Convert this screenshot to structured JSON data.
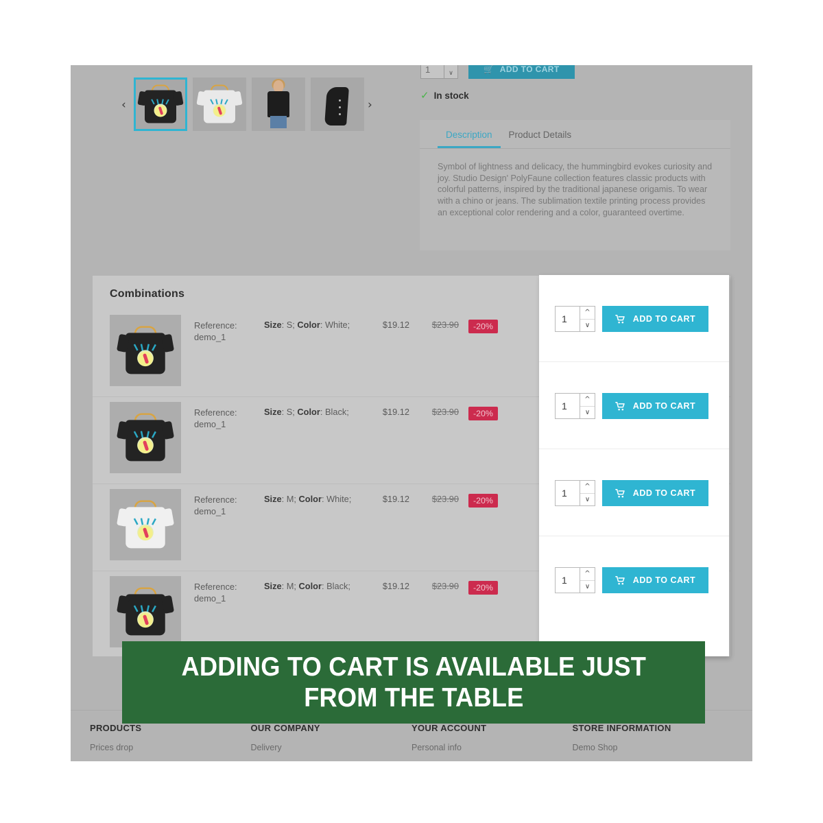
{
  "gallery": {
    "prev_label": "‹",
    "next_label": "›",
    "thumbs": [
      {
        "name": "black-tshirt-hummingbird",
        "selected": true
      },
      {
        "name": "white-tshirt-hummingbird",
        "selected": false
      },
      {
        "name": "model-wearing-black-coat",
        "selected": false
      },
      {
        "name": "black-coat-on-hanger",
        "selected": false
      }
    ]
  },
  "product_panel": {
    "quantity": "1",
    "add_to_cart_label": "ADD TO CART",
    "stock_status": "In stock",
    "check_icon": "✓"
  },
  "description_box": {
    "tabs": [
      {
        "label": "Description",
        "active": true
      },
      {
        "label": "Product Details",
        "active": false
      }
    ],
    "body": "Symbol of lightness and delicacy, the hummingbird evokes curiosity and joy. Studio Design' PolyFaune collection features classic products with colorful patterns, inspired by the traditional japanese origamis. To wear with a chino or jeans. The sublimation textile printing process provides an exceptional color rendering and a color, guaranteed overtime."
  },
  "combinations": {
    "title": "Combinations",
    "reference_label": "Reference:",
    "rows": [
      {
        "reference": "demo_1",
        "size_label": "Size",
        "size": "S",
        "color_label": "Color",
        "color": "White",
        "price": "$19.12",
        "old_price": "$23.90",
        "discount": "-20%",
        "thumb": "black-tshirt-hummingbird",
        "quantity": "1",
        "add_to_cart_label": "ADD TO CART"
      },
      {
        "reference": "demo_1",
        "size_label": "Size",
        "size": "S",
        "color_label": "Color",
        "color": "Black",
        "price": "$19.12",
        "old_price": "$23.90",
        "discount": "-20%",
        "thumb": "black-tshirt-hummingbird",
        "quantity": "1",
        "add_to_cart_label": "ADD TO CART"
      },
      {
        "reference": "demo_1",
        "size_label": "Size",
        "size": "M",
        "color_label": "Color",
        "color": "White",
        "price": "$19.12",
        "old_price": "$23.90",
        "discount": "-20%",
        "thumb": "white-tshirt-hummingbird",
        "quantity": "1",
        "add_to_cart_label": "ADD TO CART"
      },
      {
        "reference": "demo_1",
        "size_label": "Size",
        "size": "M",
        "color_label": "Color",
        "color": "Black",
        "price": "$19.12",
        "old_price": "$23.90",
        "discount": "-20%",
        "thumb": "black-tshirt-hummingbird",
        "quantity": "1",
        "add_to_cart_label": "ADD TO CART"
      }
    ]
  },
  "footer": {
    "columns": [
      {
        "heading": "PRODUCTS",
        "links": [
          "Prices drop"
        ]
      },
      {
        "heading": "OUR COMPANY",
        "links": [
          "Delivery"
        ]
      },
      {
        "heading": "YOUR ACCOUNT",
        "links": [
          "Personal info"
        ]
      },
      {
        "heading": "STORE INFORMATION",
        "links": [
          "Demo Shop"
        ]
      }
    ]
  },
  "banner": {
    "line1": "ADDING TO CART IS AVAILABLE JUST",
    "line2": "FROM THE TABLE"
  },
  "colors": {
    "accent": "#2fb5d2",
    "discount": "#cc2b4e",
    "banner_green": "#2b6b38",
    "in_stock_green": "#4ab44a"
  }
}
